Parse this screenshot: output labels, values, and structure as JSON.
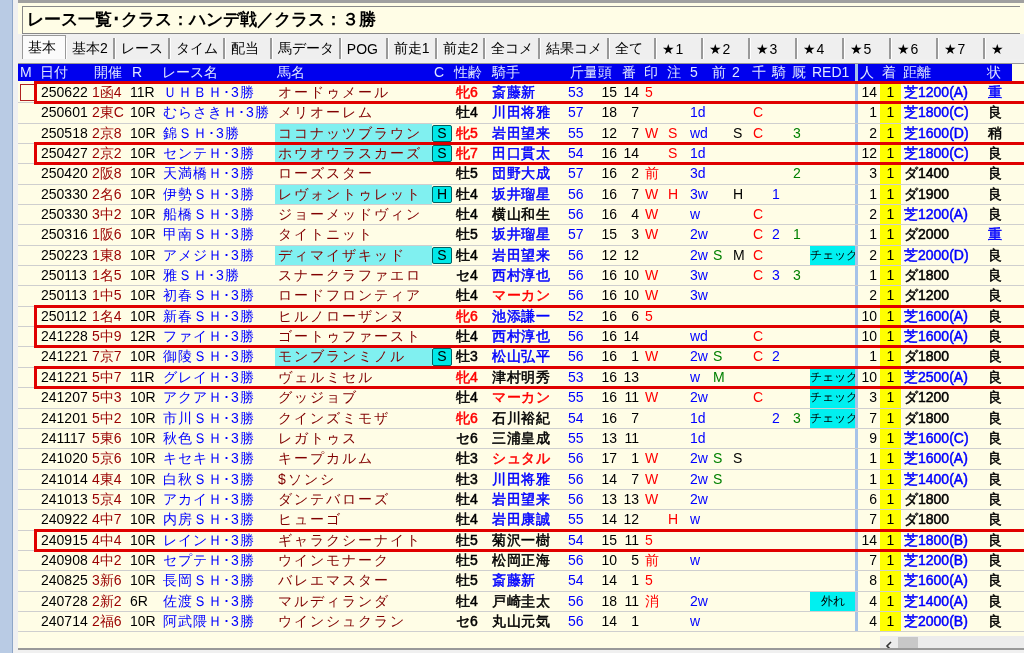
{
  "window": {
    "title": "レース一覧･クラス：ハンデ戦／クラス：３勝"
  },
  "tabs": [
    {
      "label": "基本",
      "selected": true
    },
    {
      "label": "基本2",
      "selected": false
    },
    {
      "label": "レース",
      "selected": false
    },
    {
      "label": "タイム",
      "selected": false
    },
    {
      "label": "配当",
      "selected": false
    },
    {
      "label": "馬データ",
      "selected": false
    },
    {
      "label": "POG",
      "selected": false
    },
    {
      "label": "前走1",
      "selected": false
    },
    {
      "label": "前走2",
      "selected": false
    },
    {
      "label": "全コメ",
      "selected": false
    },
    {
      "label": "結果コメ",
      "selected": false
    },
    {
      "label": "全て",
      "selected": false
    },
    {
      "label": "★1",
      "selected": false
    },
    {
      "label": "★2",
      "selected": false
    },
    {
      "label": "★3",
      "selected": false
    },
    {
      "label": "★4",
      "selected": false
    },
    {
      "label": "★5",
      "selected": false
    },
    {
      "label": "★6",
      "selected": false
    },
    {
      "label": "★7",
      "selected": false
    },
    {
      "label": "★",
      "selected": false
    }
  ],
  "table": {
    "columns": [
      "M",
      "日付",
      "開催",
      "R",
      "レース名",
      "馬名",
      "C",
      "性齢",
      "騎手",
      "斤量",
      "頭",
      "番",
      "印",
      "注",
      "5",
      "前",
      "2",
      "千",
      "騎",
      "厩",
      "RED1",
      "人",
      "着",
      "距離",
      "状"
    ],
    "rows": [
      {
        "cursor": true,
        "highlighted": true,
        "date": "250622",
        "venue": "1函4",
        "race_no": "11R",
        "race_name": "ＵＨＢＨ･3勝",
        "horse": "オードゥメール",
        "sex": {
          "text": "牝6",
          "color": "#ff0000"
        },
        "jockey": {
          "text": "斎藤新",
          "color": "#0000ff"
        },
        "weight": "53",
        "field_size": "15",
        "gate": "14",
        "mark": "5",
        "popularity": "14",
        "finish": "1",
        "distance": {
          "text": "芝1200(A)",
          "color": "#0000ff"
        },
        "condition": {
          "text": "重",
          "color": "#0000ff"
        }
      },
      {
        "cursor": false,
        "highlighted": false,
        "date": "250601",
        "venue": "2東C",
        "race_no": "10R",
        "race_name": "むらさきＨ･3勝",
        "horse": "メリオーレム",
        "sex": {
          "text": "牡4",
          "color": "#000000"
        },
        "jockey": {
          "text": "川田将雅",
          "color": "#0000ff"
        },
        "weight": "57",
        "field_size": "18",
        "gate": "7",
        "c5": "1d",
        "sen": "C",
        "popularity": "1",
        "finish": "1",
        "distance": {
          "text": "芝1800(C)",
          "color": "#0000ff"
        },
        "condition": {
          "text": "良",
          "color": "#000000"
        }
      },
      {
        "cursor": false,
        "highlighted": false,
        "date": "250518",
        "venue": "2京8",
        "race_no": "10R",
        "race_name": "錦ＳＨ･3勝",
        "horse": "ココナッツブラウン",
        "tag": "S",
        "sex": {
          "text": "牝5",
          "color": "#ff0000"
        },
        "jockey": {
          "text": "岩田望来",
          "color": "#0000ff"
        },
        "weight": "55",
        "field_size": "12",
        "gate": "7",
        "mark": "W",
        "note": "S",
        "c5": "wd",
        "c2": "S",
        "sen": "C",
        "kyu": "3",
        "popularity": "2",
        "finish": "1",
        "distance": {
          "text": "芝1600(D)",
          "color": "#0000ff"
        },
        "condition": {
          "text": "稍",
          "color": "#000000"
        }
      },
      {
        "cursor": false,
        "highlighted": true,
        "date": "250427",
        "venue": "2京2",
        "race_no": "10R",
        "race_name": "センテＨ･3勝",
        "horse": "ホウオウラスカーズ",
        "tag": "S",
        "sex": {
          "text": "牝7",
          "color": "#ff0000"
        },
        "jockey": {
          "text": "田口貫太",
          "color": "#0000ff"
        },
        "weight": "54",
        "field_size": "16",
        "gate": "14",
        "note": "S",
        "c5": "1d",
        "popularity": "12",
        "finish": "1",
        "distance": {
          "text": "芝1800(C)",
          "color": "#0000ff"
        },
        "condition": {
          "text": "良",
          "color": "#000000"
        }
      },
      {
        "cursor": false,
        "highlighted": false,
        "date": "250420",
        "venue": "2阪8",
        "race_no": "10R",
        "race_name": "天満橋Ｈ･3勝",
        "horse": "ローズスター",
        "sex": {
          "text": "牡5",
          "color": "#000000"
        },
        "jockey": {
          "text": "団野大成",
          "color": "#0000ff"
        },
        "weight": "57",
        "field_size": "16",
        "gate": "2",
        "mark": "前",
        "c5": "3d",
        "kyu": "2",
        "popularity": "3",
        "finish": "1",
        "distance": {
          "text": "ダ1400",
          "color": "#000000"
        },
        "condition": {
          "text": "良",
          "color": "#000000"
        }
      },
      {
        "cursor": false,
        "highlighted": false,
        "date": "250330",
        "venue": "2名6",
        "race_no": "10R",
        "race_name": "伊勢ＳＨ･3勝",
        "horse": "レヴォントゥレット",
        "tag": "H",
        "sex": {
          "text": "牡4",
          "color": "#000000"
        },
        "jockey": {
          "text": "坂井瑠星",
          "color": "#0000ff"
        },
        "weight": "56",
        "field_size": "16",
        "gate": "7",
        "mark": "W",
        "note": "H",
        "c5": "3w",
        "c2": "H",
        "ki": "1",
        "popularity": "1",
        "finish": "1",
        "distance": {
          "text": "ダ1900",
          "color": "#000000"
        },
        "condition": {
          "text": "良",
          "color": "#000000"
        }
      },
      {
        "cursor": false,
        "highlighted": false,
        "date": "250330",
        "venue": "3中2",
        "race_no": "10R",
        "race_name": "船橋ＳＨ･3勝",
        "horse": "ジョーメッドヴィン",
        "sex": {
          "text": "牡4",
          "color": "#000000"
        },
        "jockey": {
          "text": "横山和生",
          "color": "#000000"
        },
        "weight": "56",
        "field_size": "16",
        "gate": "4",
        "mark": "W",
        "c5": "w",
        "sen": "C",
        "popularity": "2",
        "finish": "1",
        "distance": {
          "text": "芝1200(A)",
          "color": "#0000ff"
        },
        "condition": {
          "text": "良",
          "color": "#000000"
        }
      },
      {
        "cursor": false,
        "highlighted": false,
        "date": "250316",
        "venue": "1阪6",
        "race_no": "10R",
        "race_name": "甲南ＳＨ･3勝",
        "horse": "タイトニット",
        "sex": {
          "text": "牡5",
          "color": "#000000"
        },
        "jockey": {
          "text": "坂井瑠星",
          "color": "#0000ff"
        },
        "weight": "57",
        "field_size": "15",
        "gate": "3",
        "mark": "W",
        "c5": "2w",
        "sen": "C",
        "ki": "2",
        "kyu": "1",
        "popularity": "1",
        "finish": "1",
        "distance": {
          "text": "ダ2000",
          "color": "#000000"
        },
        "condition": {
          "text": "重",
          "color": "#0000ff"
        }
      },
      {
        "cursor": false,
        "highlighted": false,
        "date": "250223",
        "venue": "1東8",
        "race_no": "10R",
        "race_name": "アメジＨ･3勝",
        "horse": "ディマイザキッド",
        "tag": "S",
        "sex": {
          "text": "牡4",
          "color": "#000000"
        },
        "jockey": {
          "text": "岩田望来",
          "color": "#0000ff"
        },
        "weight": "56",
        "field_size": "12",
        "gate": "12",
        "c5": "2w",
        "mae": "S",
        "c2": "M",
        "sen": "C",
        "red1": "チェック",
        "popularity": "2",
        "finish": "1",
        "distance": {
          "text": "芝2000(D)",
          "color": "#0000ff"
        },
        "condition": {
          "text": "良",
          "color": "#000000"
        }
      },
      {
        "cursor": false,
        "highlighted": false,
        "date": "250113",
        "venue": "1名5",
        "race_no": "10R",
        "race_name": "雅ＳＨ･3勝",
        "horse": "スナークラファエロ",
        "sex": {
          "text": "セ4",
          "color": "#000000"
        },
        "jockey": {
          "text": "西村淳也",
          "color": "#0000ff"
        },
        "weight": "56",
        "field_size": "16",
        "gate": "10",
        "mark": "W",
        "c5": "3w",
        "sen": "C",
        "ki": "3",
        "kyu": "3",
        "popularity": "1",
        "finish": "1",
        "distance": {
          "text": "ダ1800",
          "color": "#000000"
        },
        "condition": {
          "text": "良",
          "color": "#000000"
        }
      },
      {
        "cursor": false,
        "highlighted": false,
        "date": "250113",
        "venue": "1中5",
        "race_no": "10R",
        "race_name": "初春ＳＨ･3勝",
        "horse": "ロードフロンティア",
        "sex": {
          "text": "牡4",
          "color": "#000000"
        },
        "jockey": {
          "text": "マーカン",
          "color": "#ff0000"
        },
        "weight": "56",
        "field_size": "16",
        "gate": "10",
        "mark": "W",
        "c5": "3w",
        "popularity": "2",
        "finish": "1",
        "distance": {
          "text": "ダ1200",
          "color": "#000000"
        },
        "condition": {
          "text": "良",
          "color": "#000000"
        }
      },
      {
        "cursor": false,
        "highlighted": true,
        "date": "250112",
        "venue": "1名4",
        "race_no": "10R",
        "race_name": "新春ＳＨ･3勝",
        "horse": "ヒルノローザンヌ",
        "sex": {
          "text": "牝6",
          "color": "#ff0000"
        },
        "jockey": {
          "text": "池添謙一",
          "color": "#0000ff"
        },
        "weight": "52",
        "field_size": "16",
        "gate": "6",
        "mark": "5",
        "popularity": "10",
        "finish": "1",
        "distance": {
          "text": "芝1600(A)",
          "color": "#0000ff"
        },
        "condition": {
          "text": "良",
          "color": "#000000"
        }
      },
      {
        "cursor": false,
        "highlighted": true,
        "date": "241228",
        "venue": "5中9",
        "race_no": "12R",
        "race_name": "ファイＨ･3勝",
        "horse": "ゴートゥファースト",
        "sex": {
          "text": "牡4",
          "color": "#000000"
        },
        "jockey": {
          "text": "西村淳也",
          "color": "#0000ff"
        },
        "weight": "56",
        "field_size": "16",
        "gate": "14",
        "c5": "wd",
        "sen": "C",
        "popularity": "10",
        "finish": "1",
        "distance": {
          "text": "芝1600(A)",
          "color": "#0000ff"
        },
        "condition": {
          "text": "良",
          "color": "#000000"
        }
      },
      {
        "cursor": false,
        "highlighted": false,
        "date": "241221",
        "venue": "7京7",
        "race_no": "10R",
        "race_name": "御陵ＳＨ･3勝",
        "horse": "モンブランミノル",
        "tag": "S",
        "sex": {
          "text": "牡3",
          "color": "#000000"
        },
        "jockey": {
          "text": "松山弘平",
          "color": "#0000ff"
        },
        "weight": "56",
        "field_size": "16",
        "gate": "1",
        "mark": "W",
        "c5": "2w",
        "mae": "S",
        "sen": "C",
        "ki": "2",
        "popularity": "1",
        "finish": "1",
        "distance": {
          "text": "ダ1800",
          "color": "#000000"
        },
        "condition": {
          "text": "良",
          "color": "#000000"
        }
      },
      {
        "cursor": false,
        "highlighted": true,
        "date": "241221",
        "venue": "5中7",
        "race_no": "11R",
        "race_name": "グレイＨ･3勝",
        "horse": "ヴェルミセル",
        "sex": {
          "text": "牝4",
          "color": "#ff0000"
        },
        "jockey": {
          "text": "津村明秀",
          "color": "#000000"
        },
        "weight": "53",
        "field_size": "16",
        "gate": "13",
        "c5": "w",
        "mae": "M",
        "red1": "チェック",
        "popularity": "10",
        "finish": "1",
        "distance": {
          "text": "芝2500(A)",
          "color": "#0000ff"
        },
        "condition": {
          "text": "良",
          "color": "#000000"
        }
      },
      {
        "cursor": false,
        "highlighted": false,
        "date": "241207",
        "venue": "5中3",
        "race_no": "10R",
        "race_name": "アクアＨ･3勝",
        "horse": "グッジョブ",
        "sex": {
          "text": "牡4",
          "color": "#000000"
        },
        "jockey": {
          "text": "マーカン",
          "color": "#ff0000"
        },
        "weight": "55",
        "field_size": "16",
        "gate": "11",
        "mark": "W",
        "c5": "2w",
        "sen": "C",
        "red1": "チェック",
        "popularity": "3",
        "finish": "1",
        "distance": {
          "text": "ダ1200",
          "color": "#000000"
        },
        "condition": {
          "text": "良",
          "color": "#000000"
        }
      },
      {
        "cursor": false,
        "highlighted": false,
        "date": "241201",
        "venue": "5中2",
        "race_no": "10R",
        "race_name": "市川ＳＨ･3勝",
        "horse": "クインズミモザ",
        "sex": {
          "text": "牝6",
          "color": "#ff0000"
        },
        "jockey": {
          "text": "石川裕紀",
          "color": "#000000"
        },
        "weight": "54",
        "field_size": "16",
        "gate": "7",
        "c5": "1d",
        "ki": "2",
        "kyu": "3",
        "red1": "チェック",
        "popularity": "7",
        "finish": "1",
        "distance": {
          "text": "ダ1800",
          "color": "#000000"
        },
        "condition": {
          "text": "良",
          "color": "#000000"
        }
      },
      {
        "cursor": false,
        "highlighted": false,
        "date": "241117",
        "venue": "5東6",
        "race_no": "10R",
        "race_name": "秋色ＳＨ･3勝",
        "horse": "レガトゥス",
        "sex": {
          "text": "セ6",
          "color": "#000000"
        },
        "jockey": {
          "text": "三浦皇成",
          "color": "#000000"
        },
        "weight": "55",
        "field_size": "13",
        "gate": "11",
        "c5": "1d",
        "popularity": "9",
        "finish": "1",
        "distance": {
          "text": "芝1600(C)",
          "color": "#0000ff"
        },
        "condition": {
          "text": "良",
          "color": "#000000"
        }
      },
      {
        "cursor": false,
        "highlighted": false,
        "date": "241020",
        "venue": "5京6",
        "race_no": "10R",
        "race_name": "キセキＨ･3勝",
        "horse": "キープカルム",
        "sex": {
          "text": "牡3",
          "color": "#000000"
        },
        "jockey": {
          "text": "シュタル",
          "color": "#ff0000"
        },
        "weight": "56",
        "field_size": "17",
        "gate": "1",
        "mark": "W",
        "c5": "2w",
        "mae": "S",
        "c2": "S",
        "popularity": "1",
        "finish": "1",
        "distance": {
          "text": "芝1600(A)",
          "color": "#0000ff"
        },
        "condition": {
          "text": "良",
          "color": "#000000"
        }
      },
      {
        "cursor": false,
        "highlighted": false,
        "date": "241014",
        "venue": "4東4",
        "race_no": "10R",
        "race_name": "白秋ＳＨ･3勝",
        "horse": "$ソンシ",
        "sex": {
          "text": "牡3",
          "color": "#000000"
        },
        "jockey": {
          "text": "川田将雅",
          "color": "#0000ff"
        },
        "weight": "56",
        "field_size": "14",
        "gate": "7",
        "mark": "W",
        "c5": "2w",
        "mae": "S",
        "popularity": "1",
        "finish": "1",
        "distance": {
          "text": "芝1400(A)",
          "color": "#0000ff"
        },
        "condition": {
          "text": "良",
          "color": "#000000"
        }
      },
      {
        "cursor": false,
        "highlighted": false,
        "date": "241013",
        "venue": "5京4",
        "race_no": "10R",
        "race_name": "アカイＨ･3勝",
        "horse": "ダンテバローズ",
        "sex": {
          "text": "牡4",
          "color": "#000000"
        },
        "jockey": {
          "text": "岩田望来",
          "color": "#0000ff"
        },
        "weight": "56",
        "field_size": "13",
        "gate": "13",
        "mark": "W",
        "c5": "2w",
        "popularity": "6",
        "finish": "1",
        "distance": {
          "text": "ダ1800",
          "color": "#000000"
        },
        "condition": {
          "text": "良",
          "color": "#000000"
        }
      },
      {
        "cursor": false,
        "highlighted": false,
        "date": "240922",
        "venue": "4中7",
        "race_no": "10R",
        "race_name": "内房ＳＨ･3勝",
        "horse": "ヒューゴ",
        "sex": {
          "text": "牡4",
          "color": "#000000"
        },
        "jockey": {
          "text": "岩田康誠",
          "color": "#0000ff"
        },
        "weight": "55",
        "field_size": "14",
        "gate": "12",
        "note": "H",
        "c5": "w",
        "popularity": "7",
        "finish": "1",
        "distance": {
          "text": "ダ1800",
          "color": "#000000"
        },
        "condition": {
          "text": "良",
          "color": "#000000"
        }
      },
      {
        "cursor": false,
        "highlighted": true,
        "date": "240915",
        "venue": "4中4",
        "race_no": "10R",
        "race_name": "レインＨ･3勝",
        "horse": "ギャラクシーナイト",
        "sex": {
          "text": "牡5",
          "color": "#000000"
        },
        "jockey": {
          "text": "菊沢一樹",
          "color": "#000000"
        },
        "weight": "54",
        "field_size": "15",
        "gate": "11",
        "mark": "5",
        "popularity": "14",
        "finish": "1",
        "distance": {
          "text": "芝1800(B)",
          "color": "#0000ff"
        },
        "condition": {
          "text": "良",
          "color": "#000000"
        }
      },
      {
        "cursor": false,
        "highlighted": false,
        "date": "240908",
        "venue": "4中2",
        "race_no": "10R",
        "race_name": "セプテＨ･3勝",
        "horse": "ウインモナーク",
        "sex": {
          "text": "牡5",
          "color": "#000000"
        },
        "jockey": {
          "text": "松岡正海",
          "color": "#000000"
        },
        "weight": "56",
        "field_size": "10",
        "gate": "5",
        "mark": "前",
        "c5": "w",
        "popularity": "7",
        "finish": "1",
        "distance": {
          "text": "芝1200(B)",
          "color": "#0000ff"
        },
        "condition": {
          "text": "良",
          "color": "#000000"
        }
      },
      {
        "cursor": false,
        "highlighted": false,
        "date": "240825",
        "venue": "3新6",
        "race_no": "10R",
        "race_name": "長岡ＳＨ･3勝",
        "horse": "バレエマスター",
        "sex": {
          "text": "牡5",
          "color": "#000000"
        },
        "jockey": {
          "text": "斎藤新",
          "color": "#0000ff"
        },
        "weight": "54",
        "field_size": "14",
        "gate": "1",
        "mark": "5",
        "popularity": "8",
        "finish": "1",
        "distance": {
          "text": "芝1600(A)",
          "color": "#0000ff"
        },
        "condition": {
          "text": "良",
          "color": "#000000"
        }
      },
      {
        "cursor": false,
        "highlighted": false,
        "date": "240728",
        "venue": "2新2",
        "race_no": "6R",
        "race_name": "佐渡ＳＨ･3勝",
        "horse": "マルディランダ",
        "sex": {
          "text": "牡4",
          "color": "#000000"
        },
        "jockey": {
          "text": "戸崎圭太",
          "color": "#000000"
        },
        "weight": "56",
        "field_size": "18",
        "gate": "11",
        "mark": "消",
        "c5": "2w",
        "red1": "外れ",
        "popularity": "4",
        "finish": "1",
        "distance": {
          "text": "芝1400(A)",
          "color": "#0000ff"
        },
        "condition": {
          "text": "良",
          "color": "#000000"
        }
      },
      {
        "cursor": false,
        "highlighted": false,
        "date": "240714",
        "venue": "2福6",
        "race_no": "10R",
        "race_name": "阿武隈Ｈ･3勝",
        "horse": "ウインシュクラン",
        "sex": {
          "text": "セ6",
          "color": "#000000"
        },
        "jockey": {
          "text": "丸山元気",
          "color": "#000000"
        },
        "weight": "56",
        "field_size": "14",
        "gate": "1",
        "c5": "w",
        "popularity": "4",
        "finish": "1",
        "distance": {
          "text": "芝2000(B)",
          "color": "#0000ff"
        },
        "condition": {
          "text": "良",
          "color": "#000000"
        }
      }
    ]
  }
}
